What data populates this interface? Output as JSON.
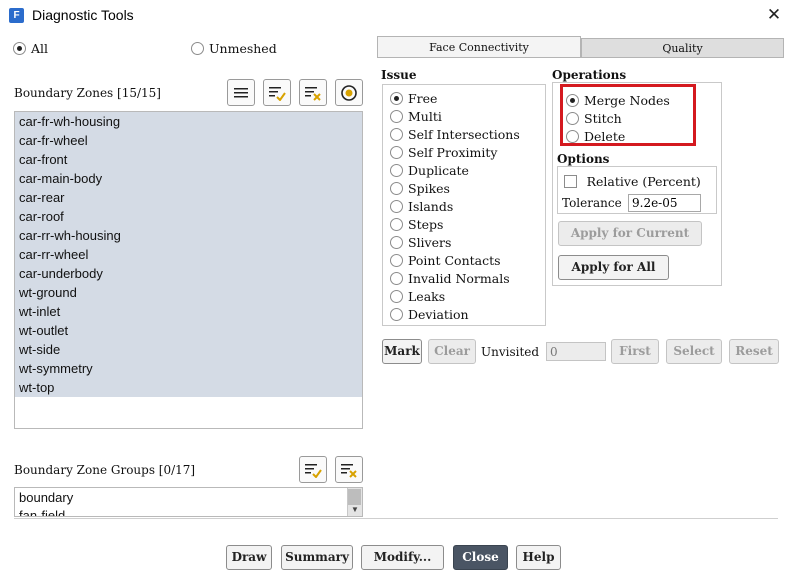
{
  "window": {
    "title": "Diagnostic Tools",
    "icon_letter": "F",
    "close_glyph": "✕"
  },
  "filter": {
    "all_label": "All",
    "unmeshed_label": "Unmeshed",
    "selected": "All"
  },
  "boundary_zones": {
    "heading": "Boundary Zones [15/15]",
    "items": [
      "car-fr-wh-housing",
      "car-fr-wheel",
      "car-front",
      "car-main-body",
      "car-rear",
      "car-roof",
      "car-rr-wh-housing",
      "car-rr-wheel",
      "car-underbody",
      "wt-ground",
      "wt-inlet",
      "wt-outlet",
      "wt-side",
      "wt-symmetry",
      "wt-top"
    ]
  },
  "boundary_zone_groups": {
    "heading": "Boundary Zone Groups [0/17]",
    "items": [
      "boundary",
      "fan-field"
    ]
  },
  "tabs": [
    {
      "label": "Face Connectivity",
      "active": true
    },
    {
      "label": "Quality",
      "active": false
    }
  ],
  "issue": {
    "heading": "Issue",
    "selected": "Free",
    "options": [
      "Free",
      "Multi",
      "Self Intersections",
      "Self Proximity",
      "Duplicate",
      "Spikes",
      "Islands",
      "Steps",
      "Slivers",
      "Point Contacts",
      "Invalid Normals",
      "Leaks",
      "Deviation"
    ]
  },
  "operations": {
    "heading": "Operations",
    "selected": "Merge Nodes",
    "options": [
      "Merge Nodes",
      "Stitch",
      "Delete"
    ],
    "highlight_color": "#d4191f"
  },
  "options": {
    "heading": "Options",
    "relative_label": "Relative (Percent)",
    "relative_checked": false,
    "tolerance_label": "Tolerance",
    "tolerance_value": "9.2e-05",
    "apply_current_label": "Apply for Current",
    "apply_all_label": "Apply for All"
  },
  "marks": {
    "mark_label": "Mark",
    "clear_label": "Clear",
    "unvisited_label": "Unvisited",
    "unvisited_value": "0",
    "first_label": "First",
    "select_label": "Select",
    "reset_label": "Reset"
  },
  "footer": {
    "draw_label": "Draw",
    "summary_label": "Summary",
    "modify_label": "Modify...",
    "close_label": "Close",
    "help_label": "Help"
  }
}
